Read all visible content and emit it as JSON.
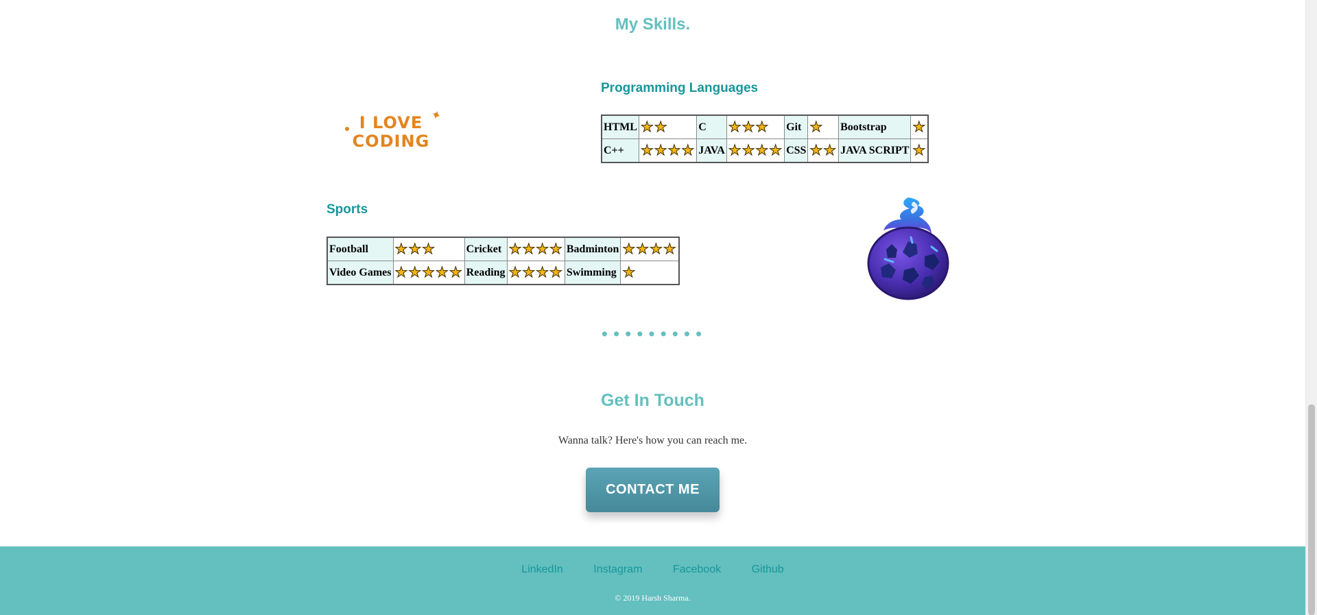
{
  "skills": {
    "title": "My Skills.",
    "logo_text_line1": "I LOVE",
    "logo_text_line2": "CODING",
    "programming": {
      "title": "Programming Languages",
      "rows": [
        [
          {
            "name": "HTML",
            "stars": 2
          },
          {
            "name": "C",
            "stars": 3
          },
          {
            "name": "Git",
            "stars": 1
          },
          {
            "name": "Bootstrap",
            "stars": 1
          }
        ],
        [
          {
            "name": "C++",
            "stars": 4
          },
          {
            "name": "JAVA",
            "stars": 4
          },
          {
            "name": "CSS",
            "stars": 2
          },
          {
            "name": "JAVA SCRIPT",
            "stars": 1
          }
        ]
      ]
    },
    "sports": {
      "title": "Sports",
      "rows": [
        [
          {
            "name": "Football",
            "stars": 3
          },
          {
            "name": "Cricket",
            "stars": 4
          },
          {
            "name": "Badminton",
            "stars": 4
          }
        ],
        [
          {
            "name": "Video Games",
            "stars": 5
          },
          {
            "name": "Reading",
            "stars": 4
          },
          {
            "name": "Swimming",
            "stars": 1
          }
        ]
      ]
    }
  },
  "separator": "•••••••••",
  "contact": {
    "title": "Get In Touch",
    "text": "Wanna talk? Here's how you can reach me.",
    "button_label": "CONTACT ME"
  },
  "footer": {
    "links": [
      "LinkedIn",
      "Instagram",
      "Facebook",
      "Github"
    ],
    "copyright": "© 2019 Harsh Sharma."
  },
  "colors": {
    "accent": "#64bfbf",
    "heading_dark": "#17979a",
    "button": "#4f95a6",
    "star": "#f5b518",
    "cell_highlight": "#e4f7f5"
  },
  "icons": {
    "star": "star-icon",
    "logo": "i-love-coding-logo",
    "ball": "flaming-ball-icon"
  }
}
